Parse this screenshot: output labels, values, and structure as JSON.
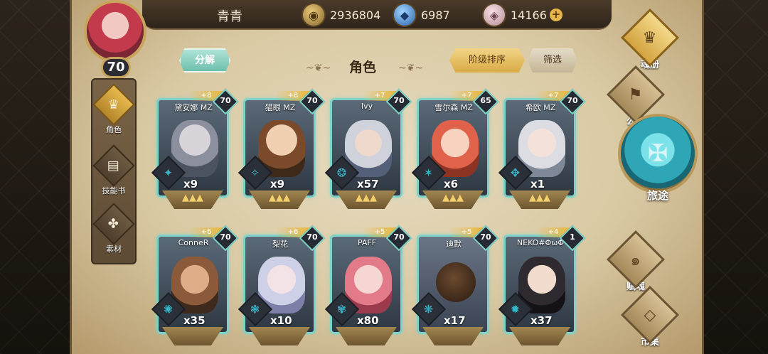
{
  "player": {
    "name": "青青",
    "level": "70"
  },
  "currencies": [
    {
      "icon": "gold-coin-icon",
      "value": "2936804"
    },
    {
      "icon": "blue-crystal-icon",
      "value": "6987"
    },
    {
      "icon": "pink-gem-icon",
      "value": "14166"
    }
  ],
  "sidebar": {
    "items": [
      {
        "label": "角色",
        "icon": "helmet-icon",
        "active": true
      },
      {
        "label": "技能书",
        "icon": "book-icon",
        "active": false
      },
      {
        "label": "素材",
        "icon": "material-icon",
        "active": false
      }
    ]
  },
  "header": {
    "decompose": "分解",
    "title": "角色",
    "sort": "阶级排序",
    "filter": "筛选"
  },
  "cards": [
    {
      "name": "黛安娜 MZ",
      "level": "70",
      "plus": "+8",
      "count": "x9"
    },
    {
      "name": "猫眼 MZ",
      "level": "70",
      "plus": "+8",
      "count": "x9"
    },
    {
      "name": "Ivy",
      "level": "70",
      "plus": "+7",
      "count": "x57"
    },
    {
      "name": "雪尔森 MZ",
      "level": "65",
      "plus": "+7",
      "count": "x6"
    },
    {
      "name": "希欧 MZ",
      "level": "70",
      "plus": "+7",
      "count": "x1"
    },
    {
      "name": "ConneR",
      "level": "70",
      "plus": "+6",
      "count": "x35"
    },
    {
      "name": "梨花",
      "level": "70",
      "plus": "+6",
      "count": "x10"
    },
    {
      "name": "PAFF",
      "level": "70",
      "plus": "+5",
      "count": "x80"
    },
    {
      "name": "迪默",
      "level": "70",
      "plus": "+5",
      "count": "x17"
    },
    {
      "name": "NEKO#ΦωΦ",
      "level": "1",
      "plus": "+4",
      "count": "x37"
    }
  ],
  "right_nav": {
    "soulbook": "魂册",
    "guild": "公会",
    "journey": "旅途",
    "soul": "赋魂",
    "market": "市集"
  },
  "colors": {
    "accent_teal": "#7fd2c7",
    "gold": "#e8b83c",
    "parchment": "#d9c9a3"
  }
}
